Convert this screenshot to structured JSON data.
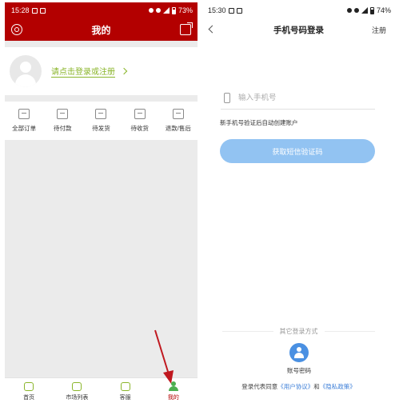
{
  "left_screen": {
    "status": {
      "time": "15:28",
      "battery": "73%"
    },
    "header": {
      "title": "我的"
    },
    "profile": {
      "login_prompt": "请点击登录或注册"
    },
    "orders": [
      {
        "label": "全部订单",
        "icon": "list-icon"
      },
      {
        "label": "待付款",
        "icon": "wallet-icon"
      },
      {
        "label": "待发货",
        "icon": "package-icon"
      },
      {
        "label": "待收货",
        "icon": "truck-icon"
      },
      {
        "label": "退款/售后",
        "icon": "refund-icon"
      }
    ],
    "tabs": [
      {
        "label": "首页",
        "icon": "home-icon"
      },
      {
        "label": "市场列表",
        "icon": "market-icon"
      },
      {
        "label": "客服",
        "icon": "chat-icon"
      },
      {
        "label": "我的",
        "icon": "person-icon",
        "active": true
      }
    ],
    "colors": {
      "header": "#b30000",
      "accent_green": "#8ab52a",
      "annotation_arrow": "#c0181f"
    }
  },
  "right_screen": {
    "status": {
      "time": "15:30",
      "battery": "74%"
    },
    "header": {
      "title": "手机号码登录",
      "register": "注册"
    },
    "phone_input": {
      "placeholder": "输入手机号"
    },
    "hint": "新手机号验证后自动创建账户",
    "sms_button": "获取短信验证码",
    "other_methods": "其它登录方式",
    "password_login": "账号密码",
    "agreement": {
      "prefix": "登录代表同意",
      "user_agreement": "《用户协议》",
      "and": "和",
      "privacy_policy": "《隐私政策》"
    },
    "colors": {
      "button": "#92c3f2",
      "link": "#3d7fd8"
    }
  }
}
